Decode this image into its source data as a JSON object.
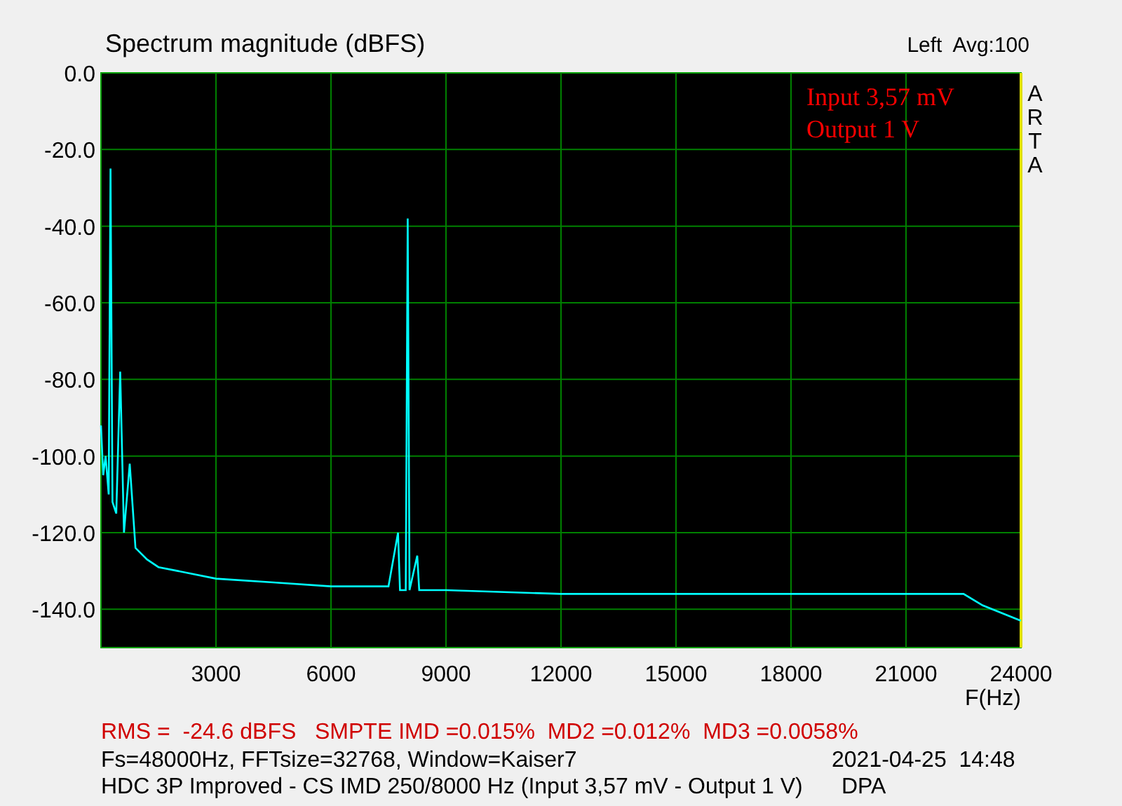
{
  "header": {
    "title": "Spectrum magnitude (dBFS)",
    "average": "Avg:100"
  },
  "plot": {
    "brand": "ARTA",
    "notes": [
      "Input 3,57 mV",
      "Output 1 V"
    ],
    "chart_data": {
      "type": "line",
      "grid": true,
      "xlabel": "F(Hz)",
      "xlim": [
        0,
        24000
      ],
      "ylim": [
        -150,
        0
      ],
      "xticks": [
        3000,
        6000,
        9000,
        12000,
        15000,
        18000,
        21000,
        24000
      ],
      "yticks": [
        {
          "value": 0,
          "label": "0.0"
        },
        {
          "value": -20,
          "label": "-20.0"
        },
        {
          "value": -40,
          "label": "-40.0"
        },
        {
          "value": -60,
          "label": "-60.0"
        },
        {
          "value": -80,
          "label": "-80.0"
        },
        {
          "value": -100,
          "label": "-100.0"
        },
        {
          "value": -120,
          "label": "-120.0"
        },
        {
          "value": -140,
          "label": "-140.0"
        }
      ],
      "x": [
        0,
        60,
        120,
        200,
        250,
        300,
        400,
        500,
        600,
        750,
        900,
        1200,
        1500,
        2000,
        3000,
        4500,
        6000,
        7500,
        7750,
        7800,
        7950,
        8000,
        8050,
        8250,
        8300,
        9000,
        12000,
        15000,
        18000,
        21000,
        22500,
        23000,
        24000
      ],
      "series": [
        {
          "name": "Left",
          "color": "#00ffff",
          "values": [
            -92,
            -105,
            -100,
            -110,
            -25,
            -112,
            -115,
            -78,
            -120,
            -102,
            -124,
            -127,
            -129,
            -130,
            -132,
            -133,
            -134,
            -134,
            -120,
            -135,
            -135,
            -38,
            -135,
            -126,
            -135,
            -135,
            -136,
            -136,
            -136,
            -136,
            -136,
            -139,
            -143
          ]
        }
      ]
    }
  },
  "footer": {
    "measurements": "RMS =  -24.6 dBFS   SMPTE IMD =0.015%  MD2 =0.012%  MD3 =0.0058%",
    "settings": "Fs=48000Hz, FFTsize=32768, Window=Kaiser7",
    "timestamp": "2021-04-25  14:48",
    "description": "HDC 3P Improved - CS IMD 250/8000 Hz (Input 3,57 mV - Output 1 V)",
    "tag": "DPA"
  }
}
